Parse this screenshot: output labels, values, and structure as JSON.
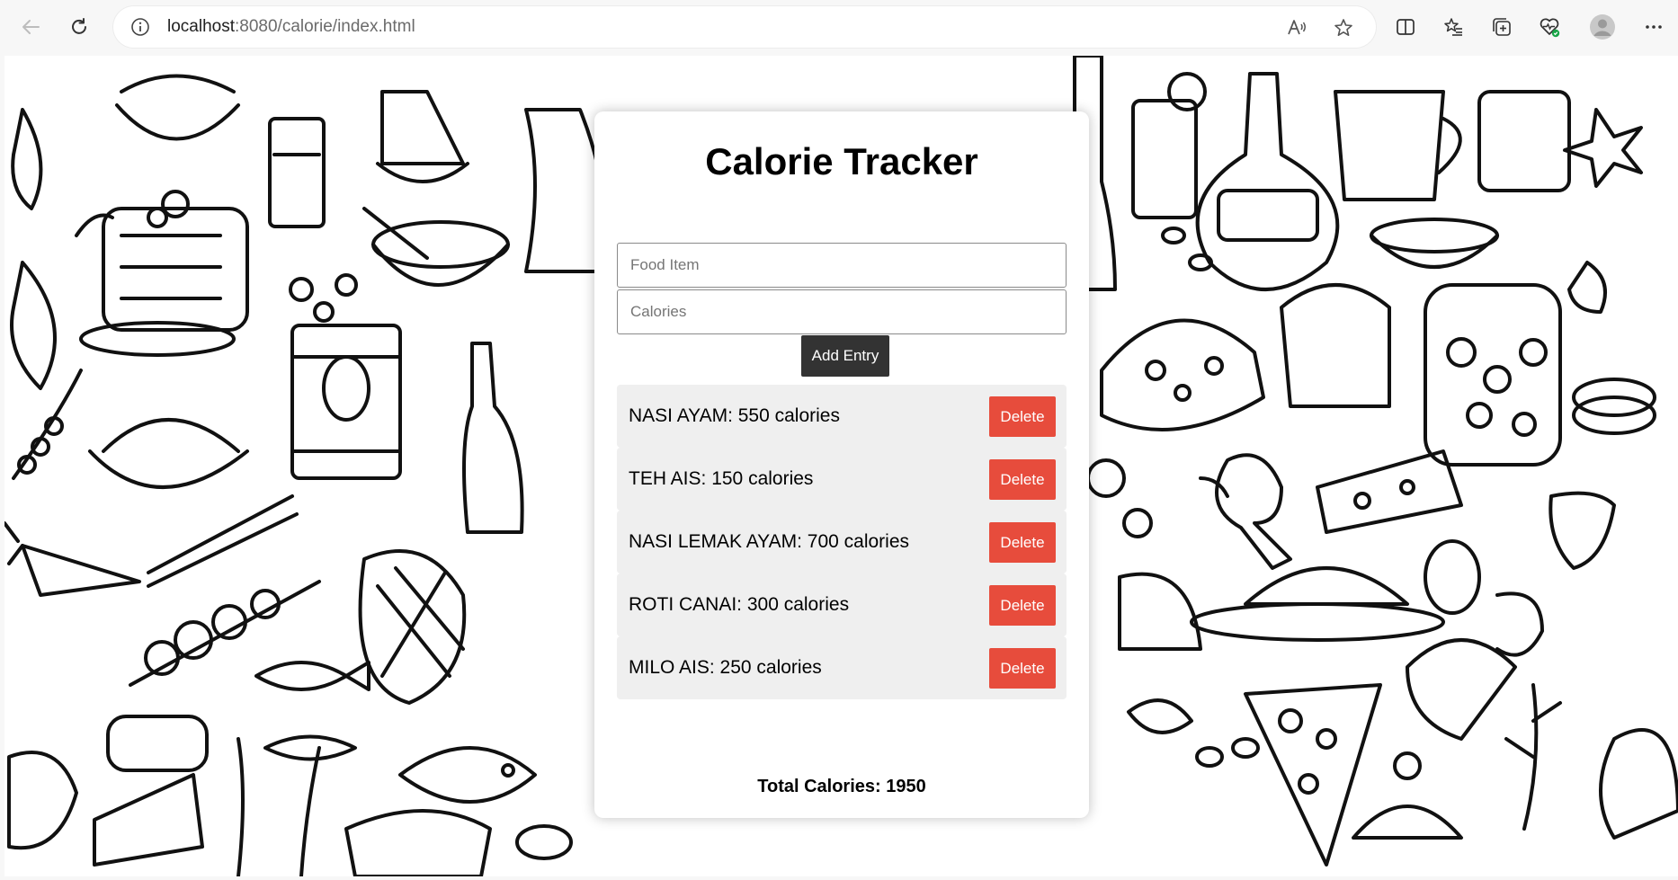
{
  "browser": {
    "url_host": "localhost",
    "url_path": ":8080/calorie/index.html"
  },
  "app": {
    "title": "Calorie Tracker",
    "food_placeholder": "Food Item",
    "food_value": "",
    "calories_placeholder": "Calories",
    "calories_value": "",
    "add_label": "Add Entry",
    "total_label": "Total Calories: 1950"
  },
  "entries": [
    {
      "text": "NASI AYAM: 550 calories",
      "delete_label": "Delete"
    },
    {
      "text": "TEH AIS: 150 calories",
      "delete_label": "Delete"
    },
    {
      "text": "NASI LEMAK AYAM: 700 calories",
      "delete_label": "Delete"
    },
    {
      "text": "ROTI CANAI: 300 calories",
      "delete_label": "Delete"
    },
    {
      "text": "MILO AIS: 250 calories",
      "delete_label": "Delete"
    }
  ],
  "colors": {
    "add_button": "#333333",
    "delete_button": "#e74c3c",
    "entry_background": "#efefef"
  },
  "icons": {
    "back": "back-arrow-icon",
    "refresh": "refresh-icon",
    "site_info": "info-icon",
    "read_aloud": "read-aloud-icon",
    "favorite": "star-icon",
    "split_screen": "split-screen-icon",
    "favorites": "favorites-list-icon",
    "collections": "collections-icon",
    "health": "browser-essentials-icon",
    "profile": "profile-avatar-icon",
    "more": "more-options-icon"
  }
}
